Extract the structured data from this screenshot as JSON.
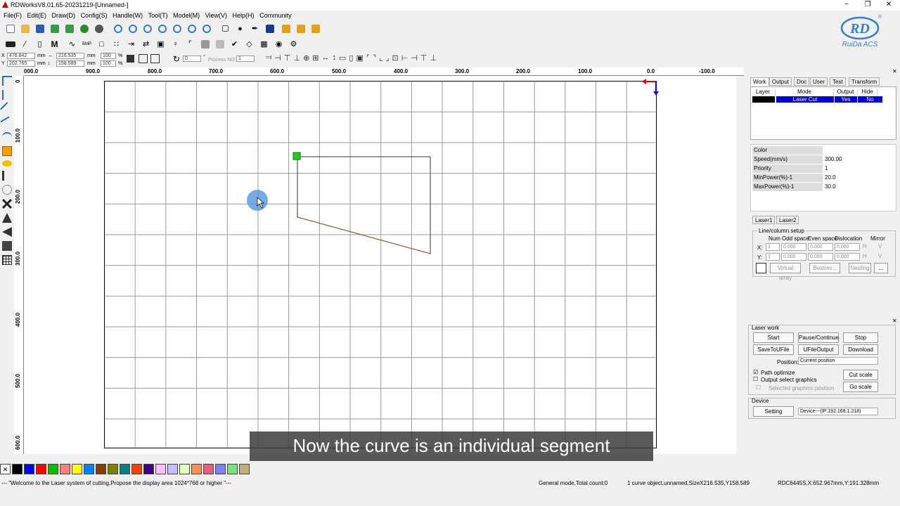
{
  "window": {
    "title": "RDWorksV8.01.65-20231219-[Unnamed-]",
    "min": "−",
    "restore": "❐",
    "close": "✕"
  },
  "menu": [
    "File(F)",
    "Edit(E)",
    "Draw(D)",
    "Config(S)",
    "Handle(W)",
    "Tool(T)",
    "Model(M)",
    "View(V)",
    "Help(H)",
    "Community"
  ],
  "logo": {
    "mark": "RD",
    "text": "RuiDa ACS",
    "registered": "®"
  },
  "coords": {
    "x_label": "X",
    "x_value": "476.842",
    "x_unit": "mm",
    "y_label": "Y",
    "y_value": "202.765",
    "y_unit": "mm",
    "w_value": "216.535",
    "w_unit": "mm",
    "h_value": "158.589",
    "h_unit": "mm",
    "sx_value": "100",
    "sx_unit": "%",
    "sy_value": "100",
    "sy_unit": "%",
    "rotate_value": "0",
    "rotate_unit": "°",
    "process_no_label": "Process NO:",
    "process_no_value": "1"
  },
  "hruler": [
    "000.0",
    "900.0",
    "800.0",
    "700.0",
    "600.0",
    "500.0",
    "400.0",
    "300.0",
    "200.0",
    "100.0",
    "0.0",
    "-100.0"
  ],
  "vruler": [
    "0",
    "100.0",
    "200.0",
    "300.0",
    "400.0",
    "500.0",
    "600.0"
  ],
  "tabs": [
    "Work",
    "Output",
    "Doc",
    "User",
    "Test",
    "Transform"
  ],
  "layer_table": {
    "headers": [
      "Layer",
      "Mode",
      "Output",
      "Hide"
    ],
    "row": {
      "mode": "Laser Cut",
      "output": "Yes",
      "hide": "No"
    }
  },
  "props": [
    {
      "k": "Color",
      "v": ""
    },
    {
      "k": "Speed(mm/s)",
      "v": "300.00"
    },
    {
      "k": "Priority",
      "v": "1"
    },
    {
      "k": "MinPower(%)-1",
      "v": "20.0"
    },
    {
      "k": "MaxPower(%)-1",
      "v": "30.0"
    }
  ],
  "laser_tabs": [
    "Laser1",
    "Laser2"
  ],
  "array": {
    "title": "Line/column setup",
    "headers": [
      "Num",
      "Odd space",
      "Even space",
      "Dislocation",
      "Mirror"
    ],
    "x_label": "X:",
    "y_label": "Y:",
    "x_num": "1",
    "y_num": "1",
    "zero": "0.000",
    "h": "H",
    "v": "V",
    "virtual": "Virtual array",
    "bestrev": "Bestrev...",
    "nesting": "Nesting",
    "more": "..."
  },
  "laser_work": {
    "title": "Laser work",
    "start": "Start",
    "pause": "Pause/Continue",
    "stop": "Stop",
    "save": "SaveToUFile",
    "ufile": "UFileOutput",
    "download": "Download",
    "position_label": "Position:",
    "position_value": "Current position",
    "path_optimize": "Path optimize",
    "output_select": "Output select graphics",
    "selected_pos": "Selected graphics position",
    "cut_scale": "Cut scale",
    "go_scale": "Go scale"
  },
  "device": {
    "title": "Device",
    "setting": "Setting",
    "value": "Device---(IP:192.168.1.218)"
  },
  "palette": [
    "#000000",
    "#0000ff",
    "#ff0000",
    "#00c000",
    "#ff8080",
    "#ffff00",
    "#0080ff",
    "#804000",
    "#808000",
    "#008080",
    "#ff4000",
    "#400080",
    "#ffc0ff",
    "#c0c0ff",
    "#e0ffc0",
    "#ff9060",
    "#e06080",
    "#8080ff",
    "#80e080",
    "#c0b080"
  ],
  "status": {
    "welcome": "--- \"Welcome to the Laser system of cutting,Propose the display area 1024*768 or higher \"---",
    "mode": "General mode,Total count:0",
    "object": "1 curve object,unnamed,SizeX216.535,Y158.589",
    "pos": "RDC6445S,X:652.967mm,Y:191.328mm"
  },
  "caption": "Now the curve is an individual segment",
  "colors": {
    "accent": "#0000cc",
    "layer": "#000000",
    "handle": "#22cc22",
    "cursor": "#4a90d9"
  }
}
